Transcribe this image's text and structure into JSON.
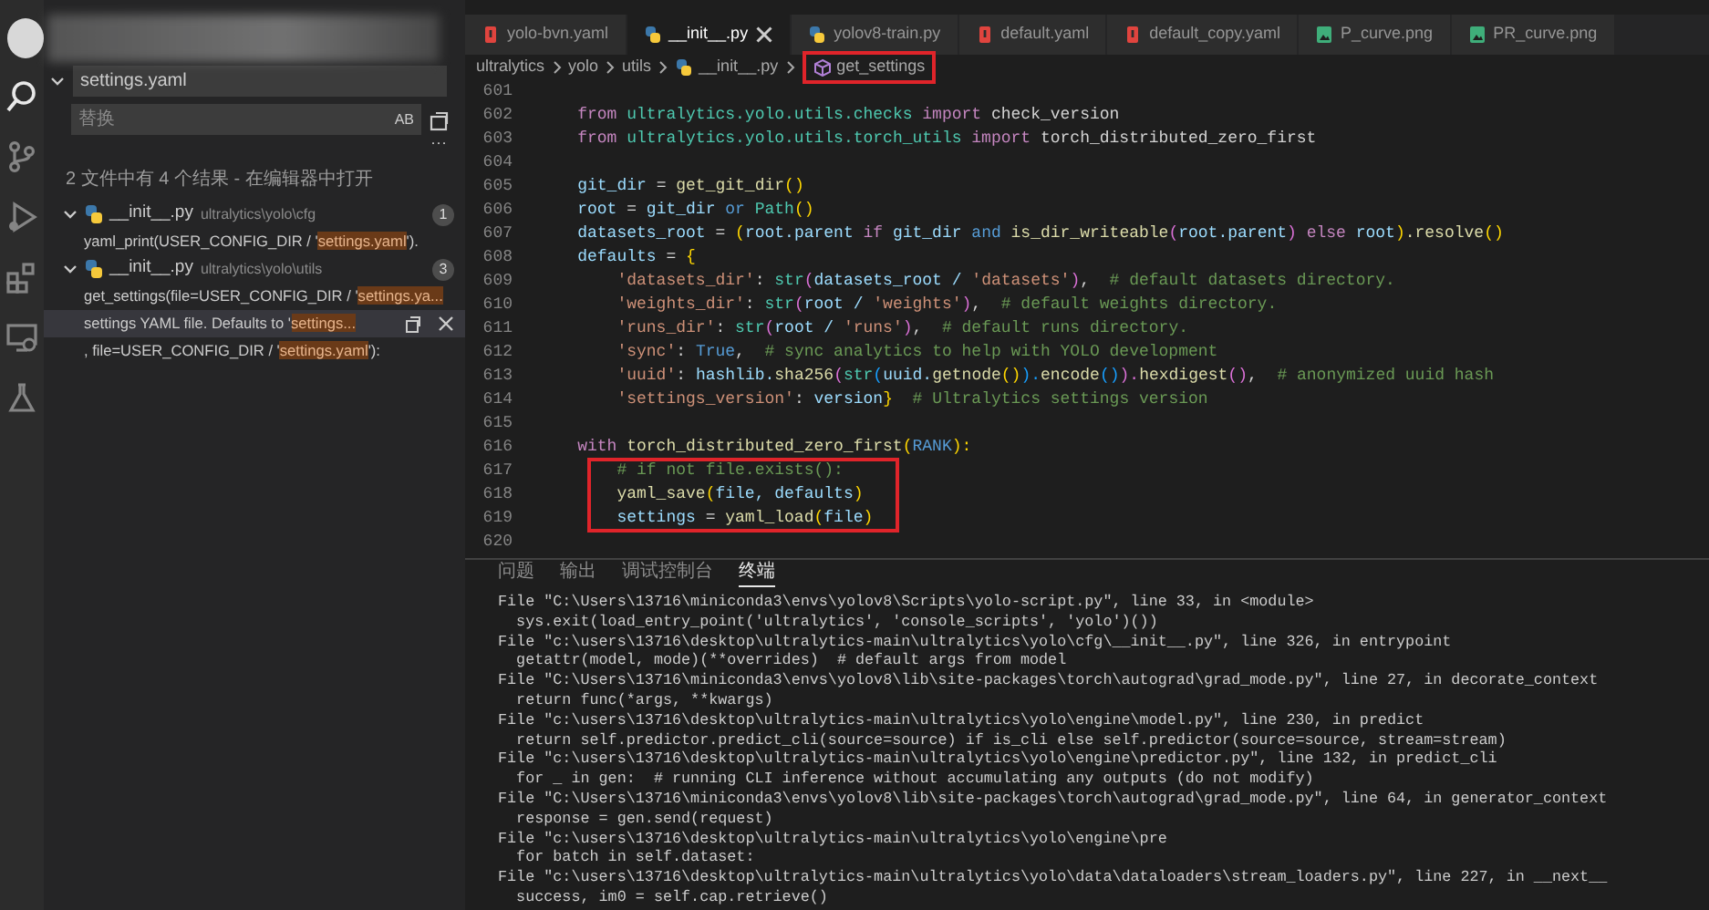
{
  "search_panel": {
    "search": {
      "value": "settings.yaml"
    },
    "replace": {
      "placeholder": "替换",
      "preserve_case": "AB"
    },
    "more": "···",
    "summary": {
      "text": "2 文件中有 4 个结果 - ",
      "link": "在编辑器中打开"
    },
    "results": [
      {
        "name": "__init__.py",
        "path": "ultralytics\\yolo\\cfg",
        "count": "1",
        "expanded": true,
        "matches": [
          {
            "before": "yaml_print(USER_CONFIG_DIR / '",
            "match": "settings.yaml",
            "after": "').",
            "selected": false
          }
        ]
      },
      {
        "name": "__init__.py",
        "path": "ultralytics\\yolo\\utils",
        "count": "3",
        "expanded": true,
        "matches": [
          {
            "before": "get_settings(file=USER_CONFIG_DIR / '",
            "match": "settings.ya...",
            "selected": false
          },
          {
            "before": "settings YAML file. Defaults to '",
            "match": "settings...",
            "selected": true
          },
          {
            "before": ", file=USER_CONFIG_DIR / '",
            "match": "settings.yaml",
            "after": "'):",
            "selected": false
          }
        ]
      }
    ]
  },
  "tabs": [
    {
      "label": "yolo-bvn.yaml",
      "kind": "yaml",
      "selected": false
    },
    {
      "label": "__init__.py",
      "kind": "python",
      "selected": true
    },
    {
      "label": "yolov8-train.py",
      "kind": "python",
      "selected": false
    },
    {
      "label": "default.yaml",
      "kind": "yaml",
      "selected": false
    },
    {
      "label": "default_copy.yaml",
      "kind": "yaml",
      "selected": false
    },
    {
      "label": "P_curve.png",
      "kind": "image",
      "selected": false
    },
    {
      "label": "PR_curve.png",
      "kind": "image",
      "selected": false
    }
  ],
  "breadcrumb": {
    "items": [
      "ultralytics",
      "yolo",
      "utils",
      "__init__.py"
    ],
    "symbol": {
      "text": "get_settings",
      "annotated": true
    }
  },
  "code_blocks": [
    {
      "annotated": false,
      "lines": [
        {
          "number": "601"
        },
        {
          "number": "602",
          "tokens": [
            {
              "text": "    from",
              "kind": "kw"
            },
            {
              "text": " ultralytics.yolo.utils.checks ",
              "kind": "mod"
            },
            {
              "text": "import",
              "kind": "kw"
            },
            {
              "text": " check_version",
              "kind": "plain"
            }
          ]
        },
        {
          "number": "603",
          "tokens": [
            {
              "text": "    from",
              "kind": "kw"
            },
            {
              "text": " ultralytics.yolo.utils.torch_utils ",
              "kind": "mod"
            },
            {
              "text": "import",
              "kind": "kw"
            },
            {
              "text": " torch_distributed_zero_first",
              "kind": "plain"
            }
          ]
        },
        {
          "number": "604"
        },
        {
          "number": "605",
          "tokens": [
            {
              "text": "    git_dir",
              "kind": "var"
            },
            {
              "text": " = ",
              "kind": "plain"
            },
            {
              "text": "get_git_dir",
              "kind": "fn"
            },
            {
              "text": "()",
              "kind": "br"
            }
          ]
        },
        {
          "number": "606",
          "tokens": [
            {
              "text": "    root",
              "kind": "var"
            },
            {
              "text": " = ",
              "kind": "plain"
            },
            {
              "text": "git_dir ",
              "kind": "var"
            },
            {
              "text": "or ",
              "kind": "const"
            },
            {
              "text": "Path",
              "kind": "mod"
            },
            {
              "text": "()",
              "kind": "br"
            }
          ]
        },
        {
          "number": "607",
          "tokens": [
            {
              "text": "    datasets_root",
              "kind": "var"
            },
            {
              "text": " = ",
              "kind": "plain"
            },
            {
              "text": "(",
              "kind": "br"
            },
            {
              "text": "root.parent ",
              "kind": "var"
            },
            {
              "text": "if ",
              "kind": "kw"
            },
            {
              "text": "git_dir ",
              "kind": "var"
            },
            {
              "text": "and ",
              "kind": "const"
            },
            {
              "text": "is_dir_writeable",
              "kind": "fn"
            },
            {
              "text": "(",
              "kind": "br2"
            },
            {
              "text": "root.parent",
              "kind": "var"
            },
            {
              "text": ")",
              "kind": "br2"
            },
            {
              "text": " else ",
              "kind": "kw"
            },
            {
              "text": "root",
              "kind": "var"
            },
            {
              "text": ")",
              "kind": "br"
            },
            {
              "text": ".resolve",
              "kind": "fn"
            },
            {
              "text": "()",
              "kind": "br"
            }
          ]
        },
        {
          "number": "608",
          "tokens": [
            {
              "text": "    defaults",
              "kind": "var"
            },
            {
              "text": " = ",
              "kind": "plain"
            },
            {
              "text": "{",
              "kind": "br"
            }
          ]
        },
        {
          "number": "609",
          "tokens": [
            {
              "text": "        'datasets_dir'",
              "kind": "str"
            },
            {
              "text": ": ",
              "kind": "plain"
            },
            {
              "text": "str",
              "kind": "mod"
            },
            {
              "text": "(",
              "kind": "br2"
            },
            {
              "text": "datasets_root / ",
              "kind": "var"
            },
            {
              "text": "'datasets'",
              "kind": "str"
            },
            {
              "text": ")",
              "kind": "br2"
            },
            {
              "text": ",  ",
              "kind": "plain"
            },
            {
              "text": "# default datasets directory.",
              "kind": "cmt"
            }
          ]
        },
        {
          "number": "610",
          "tokens": [
            {
              "text": "        'weights_dir'",
              "kind": "str"
            },
            {
              "text": ": ",
              "kind": "plain"
            },
            {
              "text": "str",
              "kind": "mod"
            },
            {
              "text": "(",
              "kind": "br2"
            },
            {
              "text": "root / ",
              "kind": "var"
            },
            {
              "text": "'weights'",
              "kind": "str"
            },
            {
              "text": ")",
              "kind": "br2"
            },
            {
              "text": ",  ",
              "kind": "plain"
            },
            {
              "text": "# default weights directory.",
              "kind": "cmt"
            }
          ]
        },
        {
          "number": "611",
          "tokens": [
            {
              "text": "        'runs_dir'",
              "kind": "str"
            },
            {
              "text": ": ",
              "kind": "plain"
            },
            {
              "text": "str",
              "kind": "mod"
            },
            {
              "text": "(",
              "kind": "br2"
            },
            {
              "text": "root / ",
              "kind": "var"
            },
            {
              "text": "'runs'",
              "kind": "str"
            },
            {
              "text": ")",
              "kind": "br2"
            },
            {
              "text": ",  ",
              "kind": "plain"
            },
            {
              "text": "# default runs directory.",
              "kind": "cmt"
            }
          ]
        },
        {
          "number": "612",
          "tokens": [
            {
              "text": "        'sync'",
              "kind": "str"
            },
            {
              "text": ": ",
              "kind": "plain"
            },
            {
              "text": "True",
              "kind": "const"
            },
            {
              "text": ",  ",
              "kind": "plain"
            },
            {
              "text": "# sync analytics to help with YOLO development",
              "kind": "cmt"
            }
          ]
        },
        {
          "number": "613",
          "tokens": [
            {
              "text": "        'uuid'",
              "kind": "str"
            },
            {
              "text": ": ",
              "kind": "plain"
            },
            {
              "text": "hashlib.",
              "kind": "var"
            },
            {
              "text": "sha256",
              "kind": "fn"
            },
            {
              "text": "(",
              "kind": "br2"
            },
            {
              "text": "str",
              "kind": "mod"
            },
            {
              "text": "(",
              "kind": "br3"
            },
            {
              "text": "uuid.",
              "kind": "var"
            },
            {
              "text": "getnode",
              "kind": "fn"
            },
            {
              "text": "()",
              "kind": "br"
            },
            {
              "text": ").",
              "kind": "br3"
            },
            {
              "text": "encode",
              "kind": "fn"
            },
            {
              "text": "()",
              "kind": "br3"
            },
            {
              "text": ").",
              "kind": "br2"
            },
            {
              "text": "hexdigest",
              "kind": "fn"
            },
            {
              "text": "()",
              "kind": "br2"
            },
            {
              "text": ",  ",
              "kind": "plain"
            },
            {
              "text": "# anonymized uuid hash",
              "kind": "cmt"
            }
          ]
        },
        {
          "number": "614",
          "tokens": [
            {
              "text": "        'settings_version'",
              "kind": "str"
            },
            {
              "text": ": ",
              "kind": "plain"
            },
            {
              "text": "version",
              "kind": "var"
            },
            {
              "text": "}",
              "kind": "br"
            },
            {
              "text": "  # Ultralytics settings version",
              "kind": "cmt"
            }
          ]
        },
        {
          "number": "615"
        },
        {
          "number": "616",
          "tokens": [
            {
              "text": "    with ",
              "kind": "kw"
            },
            {
              "text": "torch_distributed_zero_first",
              "kind": "fn"
            },
            {
              "text": "(",
              "kind": "br"
            },
            {
              "text": "RANK",
              "kind": "const"
            },
            {
              "text": "):",
              "kind": "br"
            }
          ]
        }
      ]
    },
    {
      "annotated": true,
      "lines": [
        {
          "number": "617",
          "tokens": [
            {
              "text": "        # if not file.exists():",
              "kind": "cmt"
            }
          ]
        },
        {
          "number": "618",
          "tokens": [
            {
              "text": "        yaml_save",
              "kind": "fn"
            },
            {
              "text": "(",
              "kind": "br"
            },
            {
              "text": "file, defaults",
              "kind": "var"
            },
            {
              "text": ")",
              "kind": "br"
            }
          ]
        },
        {
          "number": "619",
          "tokens": [
            {
              "text": "        settings",
              "kind": "var"
            },
            {
              "text": " = ",
              "kind": "plain"
            },
            {
              "text": "yaml_load",
              "kind": "fn"
            },
            {
              "text": "(",
              "kind": "br"
            },
            {
              "text": "file",
              "kind": "var"
            },
            {
              "text": ")",
              "kind": "br"
            }
          ]
        }
      ]
    },
    {
      "annotated": false,
      "lines": [
        {
          "number": "620"
        }
      ]
    }
  ],
  "panel": {
    "tabs": [
      {
        "label": "问题",
        "selected": false
      },
      {
        "label": "输出",
        "selected": false
      },
      {
        "label": "调试控制台",
        "selected": false
      },
      {
        "label": "终端",
        "selected": true
      }
    ],
    "terminal": [
      "File \"C:\\Users\\13716\\miniconda3\\envs\\yolov8\\Scripts\\yolo-script.py\", line 33, in <module>",
      "  sys.exit(load_entry_point('ultralytics', 'console_scripts', 'yolo')())",
      "File \"c:\\users\\13716\\desktop\\ultralytics-main\\ultralytics\\yolo\\cfg\\__init__.py\", line 326, in entrypoint",
      "  getattr(model, mode)(**overrides)  # default args from model",
      "File \"C:\\Users\\13716\\miniconda3\\envs\\yolov8\\lib\\site-packages\\torch\\autograd\\grad_mode.py\", line 27, in decorate_context",
      "  return func(*args, **kwargs)",
      "File \"c:\\users\\13716\\desktop\\ultralytics-main\\ultralytics\\yolo\\engine\\model.py\", line 230, in predict",
      "  return self.predictor.predict_cli(source=source) if is_cli else self.predictor(source=source, stream=stream)",
      "File \"c:\\users\\13716\\desktop\\ultralytics-main\\ultralytics\\yolo\\engine\\predictor.py\", line 132, in predict_cli",
      "  for _ in gen:  # running CLI inference without accumulating any outputs (do not modify)",
      "File \"C:\\Users\\13716\\miniconda3\\envs\\yolov8\\lib\\site-packages\\torch\\autograd\\grad_mode.py\", line 64, in generator_context",
      "  response = gen.send(request)",
      "File \"c:\\users\\13716\\desktop\\ultralytics-main\\ultralytics\\yolo\\engine\\pre",
      "  for batch in self.dataset:",
      "File \"c:\\users\\13716\\desktop\\ultralytics-main\\ultralytics\\yolo\\data\\dataloaders\\stream_loaders.py\", line 227, in __next__",
      "  success, im0 = self.cap.retrieve()"
    ]
  }
}
